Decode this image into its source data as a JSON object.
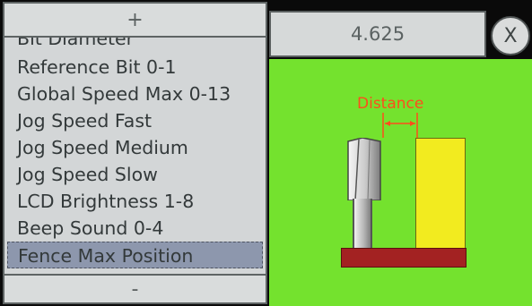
{
  "list": {
    "partial_item": "Bit Diameter",
    "items": [
      "Reference Bit 0-1",
      "Global Speed Max 0-13",
      "Jog Speed Fast",
      "Jog Speed Medium",
      "Jog Speed Slow",
      "LCD Brightness 1-8",
      "Beep Sound 0-4",
      "Fence Max Position"
    ],
    "selected_index": 7
  },
  "buttons": {
    "plus_label": "+",
    "minus_label": "-",
    "close_label": "X"
  },
  "value": {
    "display": "4.625"
  },
  "diagram": {
    "distance_label": "Distance"
  },
  "colors": {
    "diagram_background": "#74e22e",
    "fence": "#f2eb1f",
    "table": "#a32222",
    "distance_label": "#ff4d1c",
    "selected_row": "#8d97ad"
  }
}
